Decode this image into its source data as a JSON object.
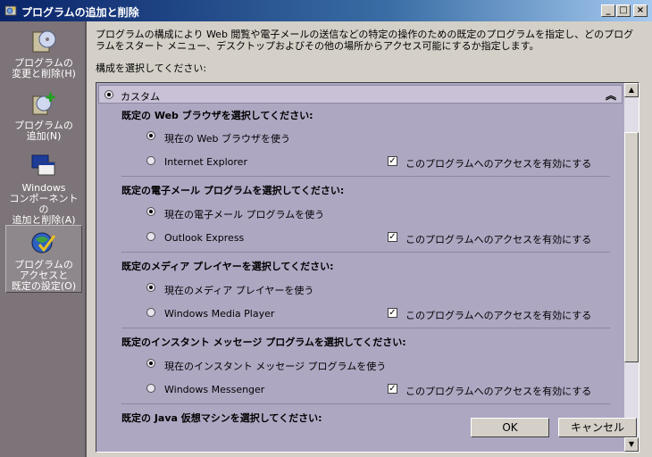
{
  "window": {
    "title": "プログラムの追加と削除",
    "controls": {
      "minimize": "_",
      "maximize": "□",
      "close": "×"
    }
  },
  "sidebar": {
    "items": [
      {
        "label": "プログラムの\n変更と削除(H)",
        "icon": "cd-box-icon",
        "selected": false
      },
      {
        "label": "プログラムの\n追加(N)",
        "icon": "add-cd-icon",
        "selected": false
      },
      {
        "label": "Windows\nコンポーネントの\n追加と削除(A)",
        "icon": "windows-components-icon",
        "selected": false
      },
      {
        "label": "プログラムの\nアクセスと\n既定の設定(O)",
        "icon": "globe-check-icon",
        "selected": true
      }
    ]
  },
  "main": {
    "description": "プログラムの構成により Web 閲覧や電子メールの送信などの特定の操作のための既定のプログラムを指定し、どのプログラムをスタート メニュー、デスクトップおよびその他の場所からアクセス可能にするか指定します。",
    "select_label": "構成を選択してください:",
    "custom_label": "カスタム",
    "collapse_glyph": "︽",
    "sections": [
      {
        "heading": "既定の Web ブラウザを選択してください:",
        "current_option": "現在の Web ブラウザを使う",
        "program_option": "Internet Explorer",
        "enable_access": "このプログラムへのアクセスを有効にする"
      },
      {
        "heading": "既定の電子メール プログラムを選択してください:",
        "current_option": "現在の電子メール プログラムを使う",
        "program_option": "Outlook Express",
        "enable_access": "このプログラムへのアクセスを有効にする"
      },
      {
        "heading": "既定のメディア プレイヤーを選択してください:",
        "current_option": "現在のメディア プレイヤーを使う",
        "program_option": "Windows Media Player",
        "enable_access": "このプログラムへのアクセスを有効にする"
      },
      {
        "heading": "既定のインスタント メッセージ プログラムを選択してください:",
        "current_option": "現在のインスタント メッセージ プログラムを使う",
        "program_option": "Windows Messenger",
        "enable_access": "このプログラムへのアクセスを有効にする"
      },
      {
        "heading": "既定の Java 仮想マシンを選択してください:"
      }
    ]
  },
  "buttons": {
    "ok": "OK",
    "cancel": "キャンセル"
  },
  "colors": {
    "titlebar_start": "#0a246a",
    "sidebar_bg": "#7c7478",
    "listbox_bg": "#aea7c2",
    "face": "#d4d0c8"
  }
}
